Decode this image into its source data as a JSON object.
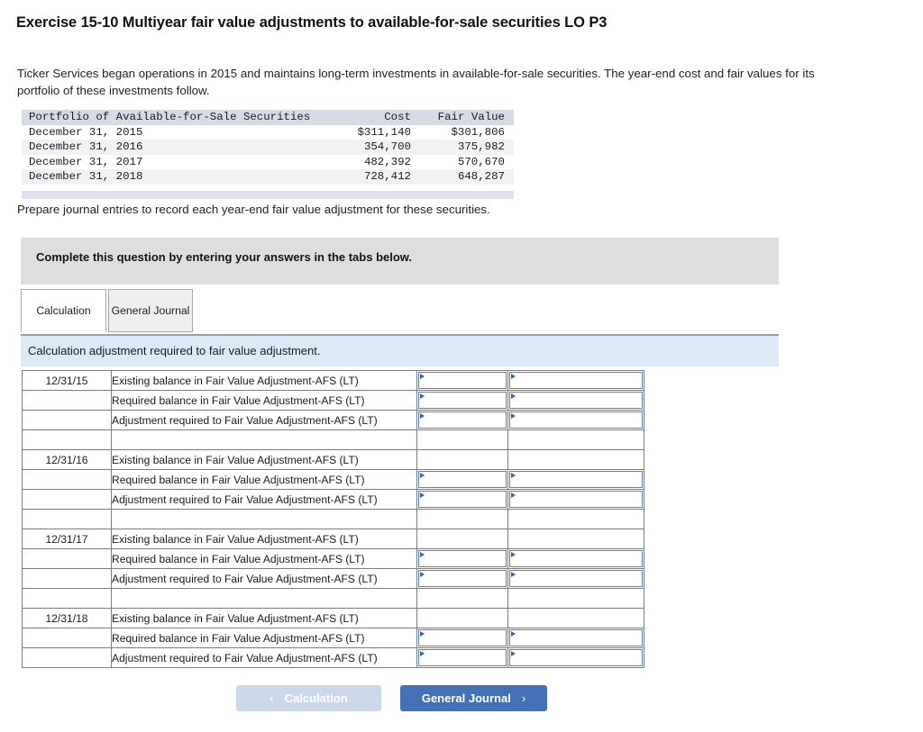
{
  "title": "Exercise 15-10 Multiyear fair value adjustments to available-for-sale securities LO P3",
  "intro": "Ticker Services began operations in 2015 and maintains long-term investments in available-for-sale securities. The year-end cost and fair values for its portfolio of these investments follow.",
  "prompt": "Prepare journal entries to record each year-end fair value adjustment for these securities.",
  "portfolio": {
    "headers": [
      "Portfolio of Available-for-Sale Securities",
      "Cost",
      "Fair Value"
    ],
    "rows": [
      {
        "name": "December 31, 2015",
        "cost": "$311,140",
        "fair_value": "$301,806"
      },
      {
        "name": "December 31, 2016",
        "cost": "354,700",
        "fair_value": "375,982"
      },
      {
        "name": "December 31, 2017",
        "cost": "482,392",
        "fair_value": "570,670"
      },
      {
        "name": "December 31, 2018",
        "cost": "728,412",
        "fair_value": "648,287"
      }
    ]
  },
  "banner": {
    "text": "Complete this question by entering your answers in the tabs below."
  },
  "tabs": [
    {
      "label": "Calculation",
      "active": true
    },
    {
      "label": "General Journal",
      "active": false
    }
  ],
  "subbar": {
    "text": "Calculation adjustment required to fair value adjustment."
  },
  "worksheet": {
    "blocks": [
      {
        "date": "12/31/15",
        "rows": [
          {
            "label": "Existing balance in Fair Value Adjustment-AFS (LT)",
            "has_fields": true
          },
          {
            "label": "Required balance in Fair Value Adjustment-AFS (LT)",
            "has_fields": true
          },
          {
            "label": "Adjustment required to Fair Value Adjustment-AFS (LT)",
            "has_fields": true
          }
        ]
      },
      {
        "date": "12/31/16",
        "rows": [
          {
            "label": "Existing balance in Fair Value Adjustment-AFS (LT)",
            "has_fields": false
          },
          {
            "label": "Required balance in Fair Value Adjustment-AFS (LT)",
            "has_fields": true
          },
          {
            "label": "Adjustment required to Fair Value Adjustment-AFS (LT)",
            "has_fields": true
          }
        ]
      },
      {
        "date": "12/31/17",
        "rows": [
          {
            "label": "Existing balance in Fair Value Adjustment-AFS (LT)",
            "has_fields": false
          },
          {
            "label": "Required balance in Fair Value Adjustment-AFS (LT)",
            "has_fields": true
          },
          {
            "label": "Adjustment required to Fair Value Adjustment-AFS (LT)",
            "has_fields": true
          }
        ]
      },
      {
        "date": "12/31/18",
        "rows": [
          {
            "label": "Existing balance in Fair Value Adjustment-AFS (LT)",
            "has_fields": false
          },
          {
            "label": "Required balance in Fair Value Adjustment-AFS (LT)",
            "has_fields": true
          },
          {
            "label": "Adjustment required to Fair Value Adjustment-AFS (LT)",
            "has_fields": true
          }
        ]
      }
    ]
  },
  "nav": {
    "prev_label": "Calculation",
    "prev_chevron": "‹",
    "next_label": "General Journal",
    "next_chevron": "›"
  },
  "colors": {
    "accent_blue": "#4471b5",
    "disabled_blue": "#ccd9ea",
    "field_border": "#5b83b8",
    "banner_grey": "#dedede",
    "subbar_blue": "#dce9f6",
    "table_header_grey": "#d7dbe4"
  }
}
